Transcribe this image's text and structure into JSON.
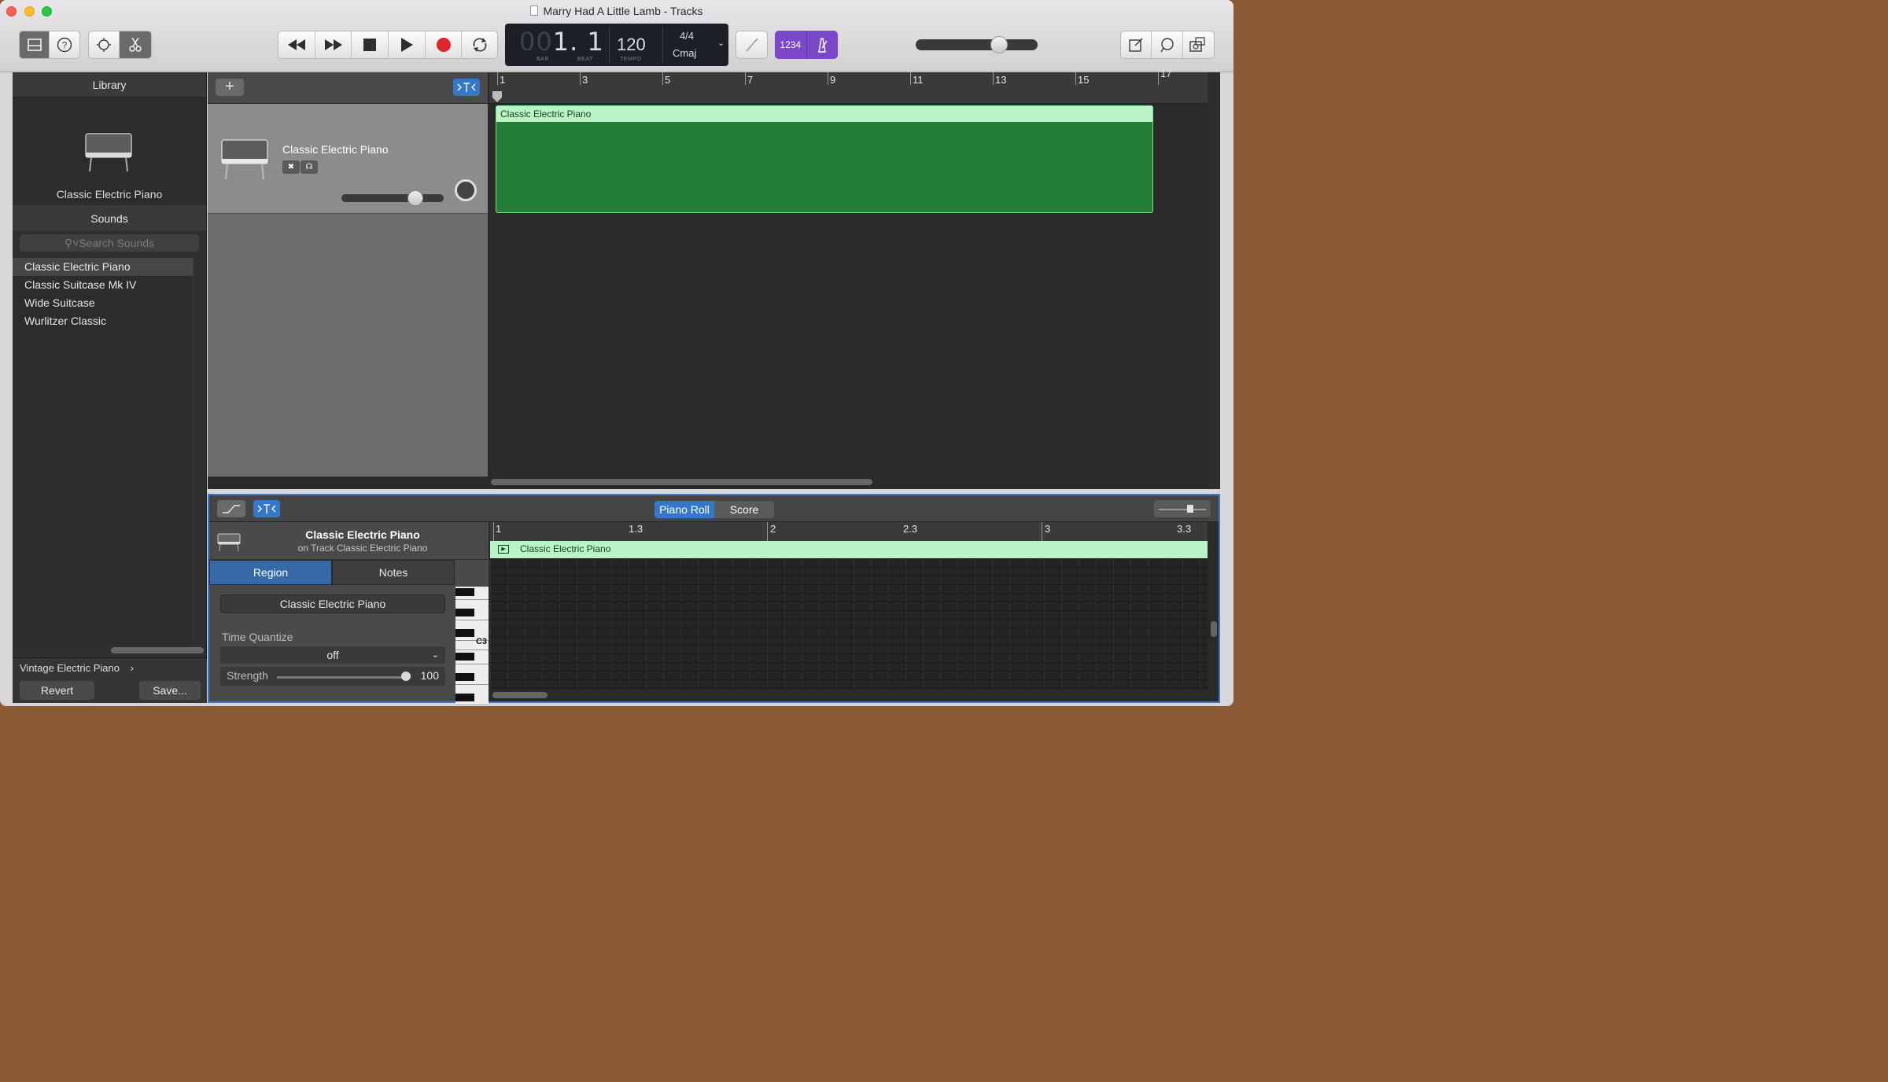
{
  "window": {
    "title": "Marry Had A Little Lamb - Tracks"
  },
  "lcd": {
    "bar_dim": "00",
    "bar": "1. 1",
    "bar_label": "BAR",
    "beat_label": "BEAT",
    "tempo": "120",
    "tempo_label": "TEMPO",
    "signature": "4/4",
    "key": "Cmaj"
  },
  "count_in": {
    "label": "1234"
  },
  "library": {
    "title": "Library",
    "instrument": "Classic Electric Piano",
    "sounds_title": "Sounds",
    "search_placeholder": "Search Sounds",
    "sounds": [
      "Classic Electric Piano",
      "Classic Suitcase Mk IV",
      "Wide Suitcase",
      "Wurlitzer Classic"
    ],
    "patch": "Vintage Electric Piano",
    "revert": "Revert",
    "save": "Save..."
  },
  "tracks": {
    "track_name": "Classic Electric Piano",
    "region_name": "Classic Electric Piano",
    "ruler": [
      "1",
      "3",
      "5",
      "7",
      "9",
      "11",
      "13",
      "15",
      "17"
    ]
  },
  "editor": {
    "tabs": [
      "Piano Roll",
      "Score"
    ],
    "inst_title": "Classic Electric Piano",
    "inst_sub": "on Track Classic Electric Piano",
    "region_tab": "Region",
    "notes_tab": "Notes",
    "region_name": "Classic Electric Piano",
    "time_quantize_label": "Time Quantize",
    "time_quantize_value": "off",
    "strength_label": "Strength",
    "strength_value": "100",
    "key_label": "C3",
    "ruler": [
      "1",
      "1.3",
      "2",
      "2.3",
      "3",
      "3.3"
    ],
    "region_label": "Classic Electric Piano"
  },
  "colors": {
    "region_green": "#237d35",
    "region_header": "#b9f5c4",
    "accent_blue": "#3577c8",
    "count_in_purple": "#7a48c8",
    "record_red": "#e0262a"
  }
}
